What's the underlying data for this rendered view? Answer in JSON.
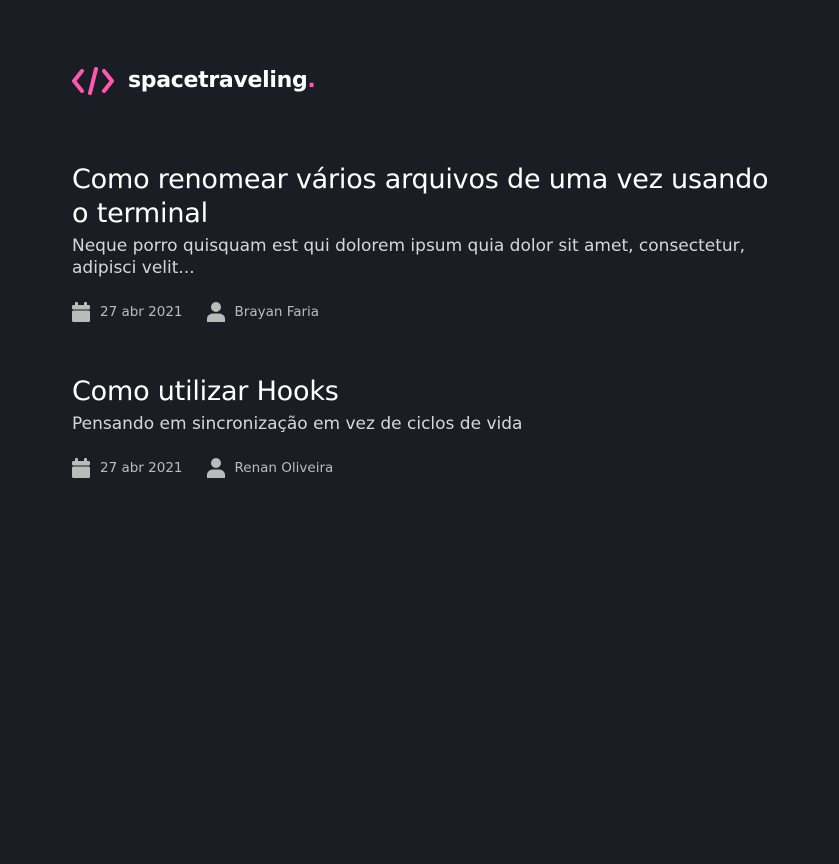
{
  "brand": {
    "name": "spacetraveling",
    "dot": ".",
    "accent_color": "#ff57b2",
    "icon": "code-icon"
  },
  "posts": [
    {
      "title": "Como renomear vários arquivos de uma vez usando o terminal",
      "subtitle": "Neque porro quisquam est qui dolorem ipsum quia dolor sit amet, consectetur, adipisci velit...",
      "date": "27 abr 2021",
      "author": "Brayan Faria",
      "date_icon": "calendar-icon",
      "author_icon": "user-icon"
    },
    {
      "title": "Como utilizar Hooks",
      "subtitle": "Pensando em sincronização em vez de ciclos de vida",
      "date": "27 abr 2021",
      "author": "Renan Oliveira",
      "date_icon": "calendar-icon",
      "author_icon": "user-icon"
    }
  ],
  "colors": {
    "background": "#1a1d23",
    "title": "#ffffff",
    "body": "#d7d7d7",
    "meta": "#bbbbbb"
  }
}
